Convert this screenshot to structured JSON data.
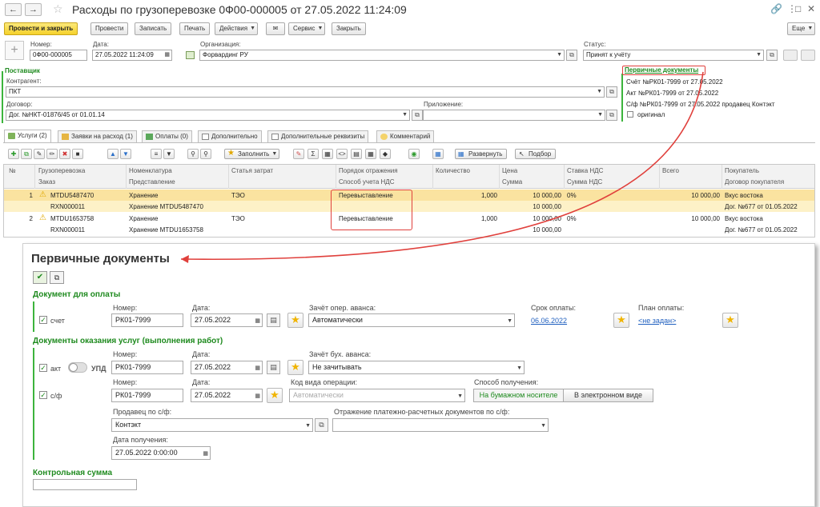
{
  "window": {
    "title": "Расходы по грузоперевозке  0Ф00-000005 от 27.05.2022 11:24:09",
    "back_icon": "arrow-left",
    "forward_icon": "arrow-right",
    "more_icon": "⋮",
    "link_icon": "🔗",
    "expand_icon": "⤢",
    "close_icon": "✕"
  },
  "toolbar": {
    "post_close": "Провести и закрыть",
    "post": "Провести",
    "save": "Записать",
    "print": "Печать",
    "actions": "Действия",
    "service": "Сервис",
    "close": "Закрыть",
    "more": "Еще"
  },
  "header": {
    "number_label": "Номер:",
    "number_value": "0Ф00-000005",
    "date_label": "Дата:",
    "date_value": "27.05.2022 11:24:09",
    "org_label": "Организация:",
    "org_value": "Форвардинг РУ",
    "status_label": "Статус:",
    "status_value": "Принят к учёту"
  },
  "supplier": {
    "section_title": "Поставщик",
    "contractor_label": "Контрагент:",
    "contractor_value": "ПКТ",
    "contract_label": "Договор:",
    "contract_value": "Дог. №НКТ-01876/45 от 01.01.14",
    "attachment_label": "Приложение:",
    "attachment_value": ""
  },
  "primary_docs": {
    "title": "Первичные документы",
    "invoice_line": "Счёт №РК01-7999 от 27.05.2022",
    "act_line": "Акт №РК01-7999 от 27.05.2022",
    "sf_line": "С/ф №РК01-7999 от 27.05.2022  продавец Контэкт",
    "original_label": "оригинал"
  },
  "tabs": [
    {
      "label": "Услуги (2)",
      "active": true
    },
    {
      "label": "Заявки на расход (1)",
      "active": false
    },
    {
      "label": "Оплаты (0)",
      "active": false
    },
    {
      "label": "Дополнительно",
      "active": false
    },
    {
      "label": "Дополнительные реквизиты",
      "active": false
    },
    {
      "label": "Комментарий",
      "active": false
    }
  ],
  "table_toolbar": {
    "fill": "Заполнить",
    "sigma": "Σ",
    "expand": "Развернуть",
    "select": "Подбор"
  },
  "table": {
    "headers_row1": [
      "№",
      "Грузоперевозка",
      "Номенклатура",
      "Статья затрат",
      "Порядок отражения",
      "Количество",
      "Цена",
      "Ставка НДС",
      "Всего",
      "Покупатель"
    ],
    "headers_row2": [
      "",
      "Заказ",
      "Представление",
      "",
      "Способ учета НДС",
      "",
      "Сумма",
      "Сумма НДС",
      "",
      "Договор покупателя"
    ],
    "rows": [
      {
        "num": "1",
        "cargo": "MTDU5487470",
        "order": "RXN000011",
        "nomenclature": "Хранение",
        "representation": "Хранение MTDU5487470",
        "cost_item": "ТЭО",
        "reflection": "Перевыставление",
        "vat_method": "",
        "qty": "1,000",
        "price": "10 000,00",
        "sum": "10 000,00",
        "vat_rate": "0%",
        "vat_sum": "",
        "total": "10 000,00",
        "buyer": "Вкус востока",
        "buyer_contract": "Дог. №677 от 01.05.2022"
      },
      {
        "num": "2",
        "cargo": "MTDU1653758",
        "order": "RXN000011",
        "nomenclature": "Хранение",
        "representation": "Хранение MTDU1653758",
        "cost_item": "ТЭО",
        "reflection": "Перевыставление",
        "vat_method": "",
        "qty": "1,000",
        "price": "10 000,00",
        "sum": "10 000,00",
        "vat_rate": "0%",
        "vat_sum": "",
        "total": "10 000,00",
        "buyer": "Вкус востока",
        "buyer_contract": "Дог. №677 от 01.05.2022"
      }
    ]
  },
  "popup": {
    "title": "Первичные документы",
    "payment_section": "Документ для оплаты",
    "invoice_check_label": "счет",
    "number_label": "Номер:",
    "invoice_number": "РК01-7999",
    "date_label": "Дата:",
    "invoice_date": "27.05.2022",
    "advance_label": "Зачёт опер. аванса:",
    "advance_value": "Автоматически",
    "due_label": "Срок оплаты:",
    "due_value": "06.06.2022",
    "plan_label": "План оплаты:",
    "plan_value": "<не задан>",
    "services_section": "Документы оказания услуг (выполнения работ)",
    "act_check_label": "акт",
    "upd_label": "УПД",
    "act_number": "РК01-7999",
    "act_date": "27.05.2022",
    "acc_advance_label": "Зачёт бух. аванса:",
    "acc_advance_value": "Не зачитывать",
    "sf_check_label": "с/ф",
    "sf_number": "РК01-7999",
    "sf_date": "27.05.2022",
    "op_code_label": "Код вида операции:",
    "op_code_placeholder": "Автоматически",
    "receive_label": "Способ получения:",
    "receive_paper": "На бумажном носителе",
    "receive_electronic": "В электронном виде",
    "seller_label": "Продавец по с/ф:",
    "seller_value": "Контэкт",
    "reflection_label": "Отражение платежно-расчетных документов по с/ф:",
    "reflection_value": "",
    "receive_date_label": "Дата получения:",
    "receive_date_value": "27.05.2022  0:00:00",
    "checksum_section": "Контрольная сумма"
  },
  "colors": {
    "accent_green": "#1e8a1e",
    "highlight_row": "#fdf1c7",
    "selected_row": "#fae3a0",
    "callout_red": "#e0403c",
    "link_blue": "#1f5fbf",
    "primary_button": "#f5d12b"
  }
}
